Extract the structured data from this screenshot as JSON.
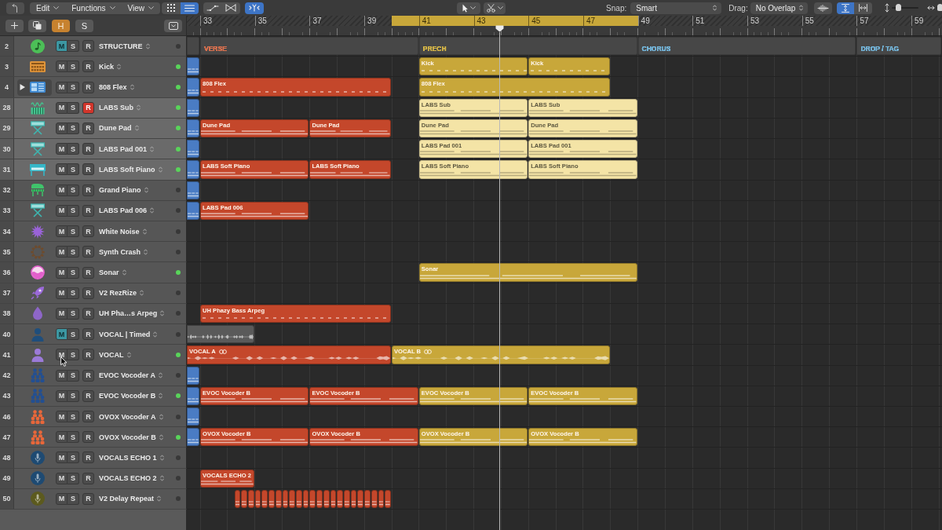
{
  "toolbar": {
    "menus": [
      {
        "label": "Edit"
      },
      {
        "label": "Functions"
      },
      {
        "label": "View"
      }
    ],
    "view_buttons": [
      {
        "selected": false
      },
      {
        "selected": true
      }
    ],
    "catch_button": {
      "on": true
    },
    "snap": {
      "label": "Snap:",
      "value": "Smart"
    },
    "drag": {
      "label": "Drag:",
      "value": "No Overlap"
    },
    "fit_buttons": [
      {
        "selected": true
      },
      {
        "selected": false
      }
    ],
    "zoom_sliders": [
      {
        "level": 0.26
      },
      {
        "level": 0.4
      }
    ]
  },
  "track_tools": {
    "buttons": [
      {
        "label": "H",
        "on": true
      },
      {
        "label": "S",
        "on": false
      }
    ]
  },
  "ruler": {
    "bars": [
      "33",
      "35",
      "37",
      "39",
      "41",
      "43",
      "45",
      "47",
      "49",
      "51",
      "53",
      "55",
      "57",
      "59"
    ],
    "cycle": {
      "on": true
    }
  },
  "tracks": [
    {
      "number": "2",
      "name": "STRUCTURE",
      "selected": false,
      "mute": {
        "label": "M",
        "on": true
      },
      "solo": {
        "label": "S",
        "on": false
      },
      "record": {
        "label": "R",
        "on": false
      },
      "active": false,
      "regions": [
        {
          "kind": "marker"
        },
        {
          "kind": "marker",
          "name": "VERSE",
          "color": "#d9714f"
        },
        {
          "kind": "marker",
          "name": "PRECH",
          "color": "#d4b548"
        },
        {
          "kind": "marker",
          "name": "CHORUS",
          "color": "#74b4d8"
        },
        {
          "kind": "marker",
          "name": "DROP / TAG",
          "color": "#74b4d8"
        }
      ]
    },
    {
      "number": "3",
      "name": "Kick",
      "selected": false,
      "mute": {
        "label": "M",
        "on": false
      },
      "solo": {
        "label": "S",
        "on": false
      },
      "record": {
        "label": "R",
        "on": false
      },
      "active": true,
      "regions": [
        {
          "kind": "notes",
          "color": "#4a7cc4"
        },
        {
          "kind": "beat",
          "name": "Kick",
          "color": "#c8a73a"
        },
        {
          "kind": "beat",
          "name": "Kick",
          "color": "#c8a73a"
        }
      ]
    },
    {
      "number": "4",
      "name": "808 Flex",
      "stack": {
        "expanded": false
      },
      "selected": false,
      "mute": {
        "label": "M",
        "on": false
      },
      "solo": {
        "label": "S",
        "on": false
      },
      "record": {
        "label": "R",
        "on": false
      },
      "active": true,
      "regions": [
        {
          "kind": "notes",
          "color": "#4a7cc4"
        },
        {
          "kind": "beat",
          "name": "808 Flex",
          "color": "#c4472b"
        },
        {
          "kind": "beat",
          "name": "808 Flex",
          "color": "#c8a73a"
        }
      ]
    },
    {
      "number": "28",
      "name": "LABS Sub",
      "selected": true,
      "mute": {
        "label": "M",
        "on": false
      },
      "solo": {
        "label": "S",
        "on": false
      },
      "record": {
        "label": "R",
        "on": true
      },
      "active": true,
      "regions": [
        {
          "kind": "notes",
          "color": "#4a7cc4"
        },
        {
          "kind": "notes",
          "name": "LABS Sub",
          "color": "#f4e4a6"
        },
        {
          "kind": "notes",
          "name": "LABS Sub",
          "color": "#f4e4a6"
        }
      ]
    },
    {
      "number": "29",
      "name": "Dune Pad",
      "selected": true,
      "mute": {
        "label": "M",
        "on": false
      },
      "solo": {
        "label": "S",
        "on": false
      },
      "record": {
        "label": "R",
        "on": false
      },
      "active": true,
      "regions": [
        {
          "kind": "notes",
          "color": "#4a7cc4"
        },
        {
          "kind": "notes",
          "name": "Dune Pad",
          "color": "#c4472b"
        },
        {
          "kind": "notes",
          "name": "Dune Pad",
          "color": "#c4472b"
        },
        {
          "kind": "notes",
          "name": "Dune Pad",
          "color": "#f4e4a6"
        },
        {
          "kind": "notes",
          "name": "Dune Pad",
          "color": "#f4e4a6"
        }
      ]
    },
    {
      "number": "30",
      "name": "LABS Pad 001",
      "selected": true,
      "mute": {
        "label": "M",
        "on": false
      },
      "solo": {
        "label": "S",
        "on": false
      },
      "record": {
        "label": "R",
        "on": false
      },
      "active": true,
      "regions": [
        {
          "kind": "notes",
          "color": "#4a7cc4"
        },
        {
          "kind": "notes",
          "name": "LABS Pad 001",
          "color": "#f4e4a6"
        },
        {
          "kind": "notes",
          "name": "LABS Pad 001",
          "color": "#f4e4a6"
        }
      ]
    },
    {
      "number": "31",
      "name": "LABS Soft Piano",
      "selected": true,
      "mute": {
        "label": "M",
        "on": false
      },
      "solo": {
        "label": "S",
        "on": false
      },
      "record": {
        "label": "R",
        "on": false
      },
      "active": true,
      "regions": [
        {
          "kind": "notes",
          "color": "#4a7cc4"
        },
        {
          "kind": "notes",
          "name": "LABS Soft Piano",
          "color": "#c4472b"
        },
        {
          "kind": "notes",
          "name": "LABS Soft Piano",
          "color": "#c4472b"
        },
        {
          "kind": "notes",
          "name": "LABS Soft Piano",
          "color": "#f4e4a6"
        },
        {
          "kind": "notes",
          "name": "LABS Soft Piano",
          "color": "#f4e4a6"
        }
      ]
    },
    {
      "number": "32",
      "name": "Grand Piano",
      "selected": false,
      "mute": {
        "label": "M",
        "on": false
      },
      "solo": {
        "label": "S",
        "on": false
      },
      "record": {
        "label": "R",
        "on": false
      },
      "active": false,
      "regions": [
        {
          "kind": "notes",
          "color": "#4a7cc4"
        }
      ]
    },
    {
      "number": "33",
      "name": "LABS Pad 006",
      "selected": false,
      "mute": {
        "label": "M",
        "on": false
      },
      "solo": {
        "label": "S",
        "on": false
      },
      "record": {
        "label": "R",
        "on": false
      },
      "active": false,
      "regions": [
        {
          "kind": "notes",
          "color": "#4a7cc4"
        },
        {
          "kind": "notes",
          "name": "LABS Pad 006",
          "color": "#c4472b"
        }
      ]
    },
    {
      "number": "34",
      "name": "White Noise",
      "selected": false,
      "mute": {
        "label": "M",
        "on": false
      },
      "solo": {
        "label": "S",
        "on": false
      },
      "record": {
        "label": "R",
        "on": false
      },
      "active": false
    },
    {
      "number": "35",
      "name": "Synth Crash",
      "selected": false,
      "mute": {
        "label": "M",
        "on": false
      },
      "solo": {
        "label": "S",
        "on": false
      },
      "record": {
        "label": "R",
        "on": false
      },
      "active": false
    },
    {
      "number": "36",
      "name": "Sonar",
      "selected": false,
      "mute": {
        "label": "M",
        "on": false
      },
      "solo": {
        "label": "S",
        "on": false
      },
      "record": {
        "label": "R",
        "on": false
      },
      "active": true,
      "regions": [
        {
          "kind": "notes",
          "name": "Sonar",
          "color": "#c8a73a"
        }
      ]
    },
    {
      "number": "37",
      "name": "V2 RezRize",
      "selected": false,
      "mute": {
        "label": "M",
        "on": false
      },
      "solo": {
        "label": "S",
        "on": false
      },
      "record": {
        "label": "R",
        "on": false
      },
      "active": false
    },
    {
      "number": "38",
      "name": "UH Pha…s Arpeg",
      "selected": false,
      "mute": {
        "label": "M",
        "on": false
      },
      "solo": {
        "label": "S",
        "on": false
      },
      "record": {
        "label": "R",
        "on": false
      },
      "active": false,
      "regions": [
        {
          "kind": "beat",
          "name": "UH Phazy Bass Arpeg",
          "color": "#c4472b"
        }
      ]
    },
    {
      "number": "40",
      "name": "VOCAL | Timed",
      "selected": false,
      "mute": {
        "label": "M",
        "on": true
      },
      "solo": {
        "label": "S",
        "on": false
      },
      "record": {
        "label": "R",
        "on": false
      },
      "active": false,
      "regions": [
        {
          "kind": "audio",
          "color": "#5a5a5a"
        }
      ]
    },
    {
      "number": "41",
      "name": "VOCAL",
      "selected": false,
      "mute": {
        "label": "M",
        "on": false
      },
      "solo": {
        "label": "S",
        "on": false
      },
      "record": {
        "label": "R",
        "on": false
      },
      "active": true,
      "regions": [
        {
          "kind": "audio",
          "name": "VOCAL A",
          "color": "#c4472b"
        },
        {
          "kind": "audio",
          "name": "VOCAL B",
          "color": "#c8a73a"
        }
      ]
    },
    {
      "number": "42",
      "name": "EVOC Vocoder A",
      "selected": false,
      "mute": {
        "label": "M",
        "on": false
      },
      "solo": {
        "label": "S",
        "on": false
      },
      "record": {
        "label": "R",
        "on": false
      },
      "active": false,
      "regions": [
        {
          "kind": "notes",
          "color": "#4a7cc4"
        }
      ]
    },
    {
      "number": "43",
      "name": "EVOC Vocoder B",
      "selected": false,
      "mute": {
        "label": "M",
        "on": false
      },
      "solo": {
        "label": "S",
        "on": false
      },
      "record": {
        "label": "R",
        "on": false
      },
      "active": true,
      "regions": [
        {
          "kind": "notes",
          "color": "#4a7cc4"
        },
        {
          "kind": "notes",
          "name": "EVOC Vocoder B",
          "color": "#c4472b"
        },
        {
          "kind": "notes",
          "name": "EVOC Vocoder B",
          "color": "#c4472b"
        },
        {
          "kind": "notes",
          "name": "EVOC Vocoder B",
          "color": "#c8a73a"
        },
        {
          "kind": "notes",
          "name": "EVOC Vocoder B",
          "color": "#c8a73a"
        }
      ]
    },
    {
      "number": "46",
      "name": "OVOX Vocoder A",
      "selected": false,
      "mute": {
        "label": "M",
        "on": false
      },
      "solo": {
        "label": "S",
        "on": false
      },
      "record": {
        "label": "R",
        "on": false
      },
      "active": false,
      "regions": [
        {
          "kind": "notes",
          "color": "#4a7cc4"
        }
      ]
    },
    {
      "number": "47",
      "name": "OVOX Vocoder B",
      "selected": false,
      "mute": {
        "label": "M",
        "on": false
      },
      "solo": {
        "label": "S",
        "on": false
      },
      "record": {
        "label": "R",
        "on": false
      },
      "active": true,
      "regions": [
        {
          "kind": "notes",
          "color": "#4a7cc4"
        },
        {
          "kind": "notes",
          "name": "OVOX Vocoder B",
          "color": "#c4472b"
        },
        {
          "kind": "notes",
          "name": "OVOX Vocoder B",
          "color": "#c4472b"
        },
        {
          "kind": "notes",
          "name": "OVOX Vocoder B",
          "color": "#c8a73a"
        },
        {
          "kind": "notes",
          "name": "OVOX Vocoder B",
          "color": "#c8a73a"
        }
      ]
    },
    {
      "number": "48",
      "name": "VOCALS ECHO 1",
      "selected": false,
      "mute": {
        "label": "M",
        "on": false
      },
      "solo": {
        "label": "S",
        "on": false
      },
      "record": {
        "label": "R",
        "on": false
      },
      "active": false
    },
    {
      "number": "49",
      "name": "VOCALS ECHO 2",
      "selected": false,
      "mute": {
        "label": "M",
        "on": false
      },
      "solo": {
        "label": "S",
        "on": false
      },
      "record": {
        "label": "R",
        "on": false
      },
      "active": false,
      "regions": [
        {
          "kind": "notes",
          "name": "VOCALS ECHO 2",
          "color": "#c4472b"
        }
      ]
    },
    {
      "number": "50",
      "name": "V2 Delay Repeat",
      "selected": false,
      "mute": {
        "label": "M",
        "on": false
      },
      "solo": {
        "label": "S",
        "on": false
      },
      "record": {
        "label": "R",
        "on": false
      },
      "active": false,
      "regions": [
        {
          "kind": "notes",
          "color": "#c4472b"
        },
        {
          "kind": "notes",
          "color": "#c4472b"
        },
        {
          "kind": "notes",
          "color": "#c4472b"
        },
        {
          "kind": "notes",
          "color": "#c4472b"
        },
        {
          "kind": "notes",
          "color": "#c4472b"
        },
        {
          "kind": "notes",
          "color": "#c4472b"
        },
        {
          "kind": "notes",
          "color": "#c4472b"
        },
        {
          "kind": "notes",
          "color": "#c4472b"
        },
        {
          "kind": "notes",
          "color": "#c4472b"
        },
        {
          "kind": "notes",
          "color": "#c4472b"
        },
        {
          "kind": "notes",
          "color": "#c4472b"
        },
        {
          "kind": "notes",
          "color": "#c4472b"
        },
        {
          "kind": "notes",
          "color": "#c4472b"
        },
        {
          "kind": "notes",
          "color": "#c4472b"
        },
        {
          "kind": "notes",
          "color": "#c4472b"
        },
        {
          "kind": "notes",
          "color": "#c4472b"
        },
        {
          "kind": "notes",
          "color": "#c4472b"
        },
        {
          "kind": "notes",
          "color": "#c4472b"
        },
        {
          "kind": "notes",
          "color": "#c4472b"
        },
        {
          "kind": "notes",
          "color": "#c4472b"
        },
        {
          "kind": "notes",
          "color": "#c4472b"
        },
        {
          "kind": "notes",
          "color": "#c4472b"
        },
        {
          "kind": "notes",
          "color": "#c4472b"
        }
      ]
    }
  ]
}
